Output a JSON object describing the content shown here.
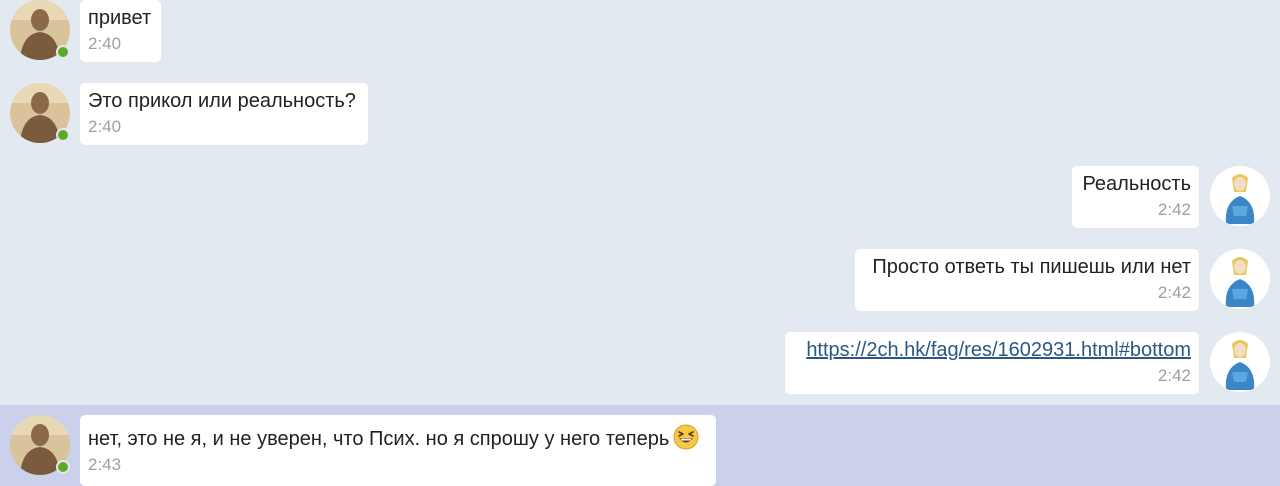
{
  "messages": [
    {
      "direction": "in",
      "text": "привет",
      "time": "2:40",
      "online": true
    },
    {
      "direction": "in",
      "text": "Это прикол или реальность?",
      "time": "2:40",
      "online": true
    },
    {
      "direction": "out",
      "text": "Реальность",
      "time": "2:42"
    },
    {
      "direction": "out",
      "text": "Просто ответь ты пишешь или нет",
      "time": "2:42"
    },
    {
      "direction": "out",
      "text": "https://2ch.hk/fag/res/1602931.html#bottom",
      "time": "2:42",
      "is_link": true
    },
    {
      "direction": "in",
      "text": "нет, это не я, и не уверен, что Псих. но я спрошу у него теперь",
      "time": "2:43",
      "online": true,
      "emoji": "grinning-squinting-face-emoji",
      "highlighted": true
    }
  ],
  "colors": {
    "background": "#e3e9f0",
    "highlight_row": "#cbd1ea",
    "bubble": "#ffffff",
    "text": "#222222",
    "time": "#9aa0a8",
    "link": "#2a5885",
    "online": "#5fa82a"
  }
}
